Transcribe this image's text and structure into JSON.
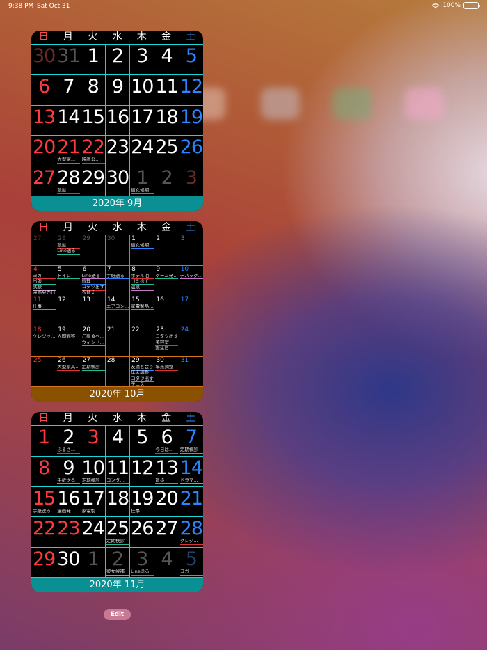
{
  "status_bar": {
    "time": "9:38 PM",
    "date": "Sat Oct 31",
    "battery": "100%"
  },
  "weekdays": [
    "日",
    "月",
    "火",
    "水",
    "木",
    "金",
    "土"
  ],
  "widgets": [
    {
      "style": "large",
      "line_color": "#19d4d4",
      "footer_color": "#0a8f92",
      "title": "2020年 9月",
      "weeks": [
        [
          {
            "d": "30",
            "c": "dimred"
          },
          {
            "d": "31",
            "c": "dim"
          },
          {
            "d": "1"
          },
          {
            "d": "2"
          },
          {
            "d": "3"
          },
          {
            "d": "4"
          },
          {
            "d": "5",
            "c": "blue"
          }
        ],
        [
          {
            "d": "6",
            "c": "red"
          },
          {
            "d": "7"
          },
          {
            "d": "8"
          },
          {
            "d": "9"
          },
          {
            "d": "10"
          },
          {
            "d": "11"
          },
          {
            "d": "12",
            "c": "blue"
          }
        ],
        [
          {
            "d": "13",
            "c": "red"
          },
          {
            "d": "14"
          },
          {
            "d": "15"
          },
          {
            "d": "16"
          },
          {
            "d": "17"
          },
          {
            "d": "18"
          },
          {
            "d": "19",
            "c": "blue"
          }
        ],
        [
          {
            "d": "20",
            "c": "red"
          },
          {
            "d": "21",
            "c": "red",
            "ev": [
              "大型家…"
            ]
          },
          {
            "d": "22",
            "c": "red",
            "ev": [
              "映画公…"
            ]
          },
          {
            "d": "23"
          },
          {
            "d": "24"
          },
          {
            "d": "25"
          },
          {
            "d": "26",
            "c": "blue"
          }
        ],
        [
          {
            "d": "27",
            "c": "red"
          },
          {
            "d": "28",
            "ev": [
              "散髪"
            ]
          },
          {
            "d": "29"
          },
          {
            "d": "30"
          },
          {
            "d": "1",
            "c": "dim",
            "ev": [
              "彼女候補"
            ]
          },
          {
            "d": "2",
            "c": "dim"
          },
          {
            "d": "3",
            "c": "dimred"
          }
        ]
      ]
    },
    {
      "style": "small",
      "line_color": "#d47319",
      "footer_color": "#8a5200",
      "title": "2020年 10月",
      "weeks": [
        [
          {
            "d": "27",
            "c": "dimred"
          },
          {
            "d": "28",
            "c": "dim",
            "ev": [
              "散髪",
              "Line送る"
            ]
          },
          {
            "d": "29",
            "c": "dim"
          },
          {
            "d": "30",
            "c": "dim"
          },
          {
            "d": "1",
            "ev": [
              "彼女候補"
            ]
          },
          {
            "d": "2"
          },
          {
            "d": "3",
            "c": "blue"
          }
        ],
        [
          {
            "d": "4",
            "c": "red",
            "ev": [
              "ヨガ",
              "出張",
              "試験",
              "漫画発売日"
            ]
          },
          {
            "d": "5",
            "ev": [
              "トイレ"
            ]
          },
          {
            "d": "6",
            "ev": [
              "Line送る",
              "料理",
              "コタツ出す",
              "衣替え"
            ]
          },
          {
            "d": "7",
            "ev": [
              "手紙送る"
            ]
          },
          {
            "d": "8",
            "ev": [
              "ホテル泊",
              "ゴミ捨て",
              "温泉"
            ]
          },
          {
            "d": "9",
            "ev": [
              "ゲーム発…"
            ]
          },
          {
            "d": "10",
            "c": "blue",
            "ev": [
              "デバッグ…"
            ]
          }
        ],
        [
          {
            "d": "11",
            "c": "red",
            "ev": [
              "仕事"
            ]
          },
          {
            "d": "12"
          },
          {
            "d": "13"
          },
          {
            "d": "14",
            "ev": [
              "エアコン…"
            ]
          },
          {
            "d": "15",
            "ev": [
              "家電製品…"
            ]
          },
          {
            "d": "16"
          },
          {
            "d": "17",
            "c": "blue"
          }
        ],
        [
          {
            "d": "18",
            "c": "red",
            "ev": [
              "クレジッ…"
            ]
          },
          {
            "d": "19",
            "ev": [
              "人間観察"
            ]
          },
          {
            "d": "20",
            "ev": [
              "ご飯食べ…",
              "ウィンド…"
            ]
          },
          {
            "d": "21"
          },
          {
            "d": "22"
          },
          {
            "d": "23",
            "ev": [
              "コタツ出す",
              "美容室",
              "誕生日"
            ]
          },
          {
            "d": "24",
            "c": "blue"
          }
        ],
        [
          {
            "d": "25",
            "c": "red"
          },
          {
            "d": "26",
            "ev": [
              "大型家具…"
            ]
          },
          {
            "d": "27",
            "ev": [
              "定期検診"
            ]
          },
          {
            "d": "28"
          },
          {
            "d": "29",
            "ev": [
              "友達と会う",
              "年末調整",
              "コタツ出す",
              "テニス"
            ]
          },
          {
            "d": "30",
            "ev": [
              "年末調整"
            ]
          },
          {
            "d": "31",
            "c": "blue"
          }
        ]
      ]
    },
    {
      "style": "large",
      "line_color": "#19d4d4",
      "footer_color": "#0a8f92",
      "title": "2020年 11月",
      "weeks": [
        [
          {
            "d": "1",
            "c": "red"
          },
          {
            "d": "2",
            "ev": [
              "ふるさ…"
            ]
          },
          {
            "d": "3",
            "c": "red"
          },
          {
            "d": "4"
          },
          {
            "d": "5"
          },
          {
            "d": "6",
            "ev": [
              "今日は…"
            ]
          },
          {
            "d": "7",
            "c": "blue",
            "ev": [
              "定期検診"
            ]
          }
        ],
        [
          {
            "d": "8",
            "c": "red"
          },
          {
            "d": "9",
            "ev": [
              "手紙送る"
            ]
          },
          {
            "d": "10",
            "ev": [
              "定期検診"
            ]
          },
          {
            "d": "11",
            "ev": [
              "コンタ…"
            ]
          },
          {
            "d": "12"
          },
          {
            "d": "13",
            "ev": [
              "散歩"
            ]
          },
          {
            "d": "14",
            "c": "blue",
            "ev": [
              "ドラマ…"
            ]
          }
        ],
        [
          {
            "d": "15",
            "c": "red",
            "ev": [
              "手紙送る"
            ]
          },
          {
            "d": "16",
            "ev": [
              "漫画発…"
            ]
          },
          {
            "d": "17",
            "ev": [
              "家電製…"
            ]
          },
          {
            "d": "18"
          },
          {
            "d": "19",
            "ev": [
              "仕事"
            ]
          },
          {
            "d": "20"
          },
          {
            "d": "21",
            "c": "blue"
          }
        ],
        [
          {
            "d": "22",
            "c": "red"
          },
          {
            "d": "23",
            "c": "red"
          },
          {
            "d": "24"
          },
          {
            "d": "25",
            "ev": [
              "定期検診"
            ]
          },
          {
            "d": "26"
          },
          {
            "d": "27"
          },
          {
            "d": "28",
            "c": "blue",
            "ev": [
              "クレジ…"
            ]
          }
        ],
        [
          {
            "d": "29",
            "c": "red"
          },
          {
            "d": "30"
          },
          {
            "d": "1",
            "c": "dim"
          },
          {
            "d": "2",
            "c": "dim",
            "ev": [
              "彼女候補"
            ]
          },
          {
            "d": "3",
            "c": "dim",
            "ev": [
              "Line送る"
            ]
          },
          {
            "d": "4",
            "c": "dim"
          },
          {
            "d": "5",
            "c": "dimblue",
            "ev": [
              "ヨガ"
            ]
          }
        ]
      ]
    }
  ],
  "edit_button": {
    "label": "Edit"
  },
  "event_colors": [
    "#2a86ff",
    "#d33",
    "#2b9",
    "#c7c"
  ]
}
